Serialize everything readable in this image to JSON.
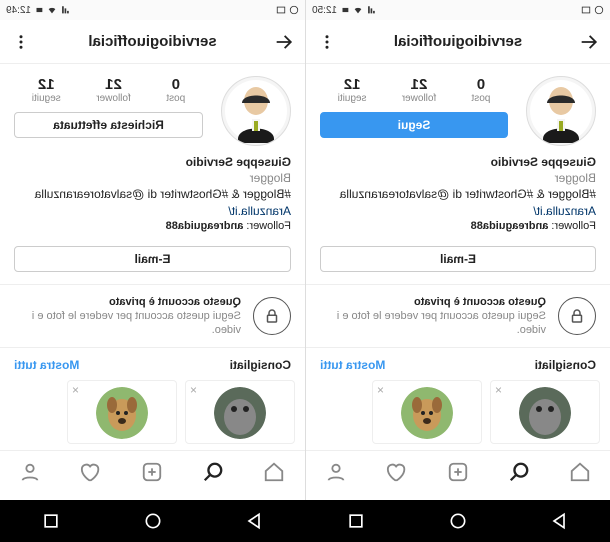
{
  "left": {
    "status_time": "12:50",
    "username": "servidiogiuofficial",
    "stats": {
      "posts_n": "0",
      "posts_l": "post",
      "followers_n": "21",
      "followers_l": "follower",
      "following_n": "12",
      "following_l": "seguiti"
    },
    "follow_label": "Segui",
    "bio": {
      "name": "Giuseppe Servidio",
      "category": "Blogger",
      "desc": "#Blogger & #Ghostwriter di @salvatorearanzulla",
      "link": "Aranzulla.it/",
      "followed_by_prefix": "Follower: ",
      "followed_by_name": "andreaguida88"
    },
    "email_label": "E-mail",
    "private": {
      "title": "Questo account è privato",
      "sub": "Segui questo account per vedere le foto e i video."
    },
    "suggest": {
      "title": "Consigliati",
      "all": "Mostra tutti"
    }
  },
  "right": {
    "status_time": "12:49",
    "username": "servidiogiuofficial",
    "stats": {
      "posts_n": "0",
      "posts_l": "post",
      "followers_n": "21",
      "followers_l": "follower",
      "following_n": "12",
      "following_l": "seguiti"
    },
    "follow_label": "Richiesta effettuata",
    "bio": {
      "name": "Giuseppe Servidio",
      "category": "Blogger",
      "desc": "#Blogger & #Ghostwriter di @salvatorearanzulla",
      "link": "Aranzulla.it/",
      "followed_by_prefix": "Follower: ",
      "followed_by_name": "andreaguida88"
    },
    "email_label": "E-mail",
    "private": {
      "title": "Questo account è privato",
      "sub": "Segui questo account per vedere le foto e i video."
    },
    "suggest": {
      "title": "Consigliati",
      "all": "Mostra tutti"
    }
  }
}
